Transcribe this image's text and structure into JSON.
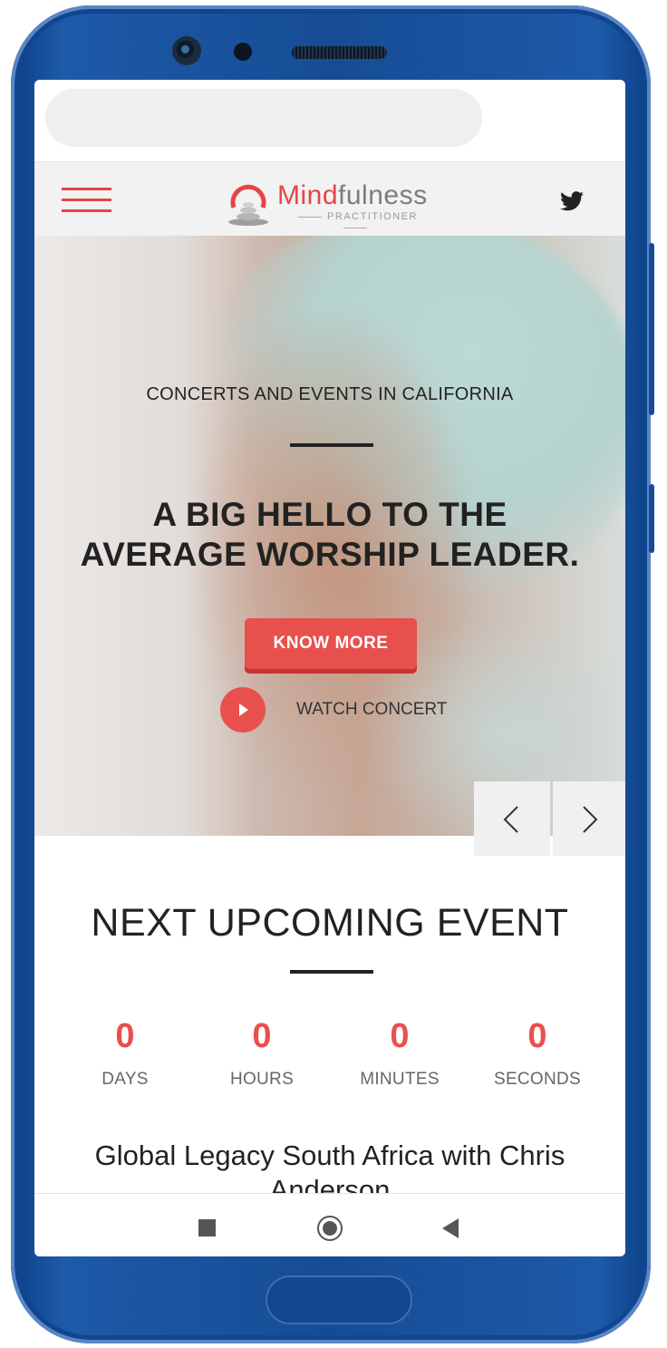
{
  "browser": {
    "url": ""
  },
  "header": {
    "logo_text_red": "Mind",
    "logo_text_gray": "fulness",
    "logo_subtitle": "PRACTITIONER",
    "menu_icon": "hamburger-icon",
    "social_icon": "twitter-icon"
  },
  "hero": {
    "subtitle": "CONCERTS AND EVENTS IN CALIFORNIA",
    "title_line1": "A BIG HELLO TO THE",
    "title_line2": "AVERAGE WORSHIP LEADER.",
    "cta_label": "KNOW MORE",
    "watch_label": "WATCH CONCERT"
  },
  "upcoming": {
    "title": "NEXT UPCOMING EVENT",
    "countdown": [
      {
        "value": "0",
        "label": "DAYS"
      },
      {
        "value": "0",
        "label": "HOURS"
      },
      {
        "value": "0",
        "label": "MINUTES"
      },
      {
        "value": "0",
        "label": "SECONDS"
      }
    ],
    "event_title": "Global Legacy South Africa with Chris Anderson"
  },
  "colors": {
    "accent": "#e8504d",
    "phone_frame": "#164c95",
    "text": "#222222"
  }
}
